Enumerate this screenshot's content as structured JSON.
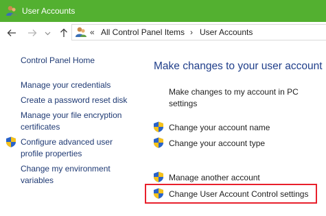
{
  "window": {
    "title": "User Accounts",
    "title_bar_color": "#53b030"
  },
  "nav": {
    "back_icon": "arrow-left-icon",
    "forward_icon": "arrow-right-icon",
    "recent_icon": "chevron-down-icon",
    "up_icon": "arrow-up-icon",
    "overflow": "«",
    "breadcrumbs": [
      "All Control Panel Items",
      "User Accounts"
    ],
    "separator": "›"
  },
  "sidebar": {
    "home": "Control Panel Home",
    "links": [
      {
        "label": "Manage your credentials"
      },
      {
        "label": "Create a password reset disk"
      },
      {
        "label_line1": "Manage your file encryption",
        "label_line2": "certificates"
      },
      {
        "label_line1": "Configure advanced user",
        "label_line2": "profile properties",
        "icon": "uac-shield-icon"
      },
      {
        "label_line1": "Change my environment",
        "label_line2": "variables"
      }
    ]
  },
  "main": {
    "heading": "Make changes to your user account",
    "pc_settings_line1": "Make changes to my account in PC",
    "pc_settings_line2": "settings",
    "actions": [
      {
        "label": "Change your account name",
        "icon": "uac-shield-icon"
      },
      {
        "label": "Change your account type",
        "icon": "uac-shield-icon"
      },
      {
        "label": "Manage another account",
        "icon": "uac-shield-icon"
      },
      {
        "label": "Change User Account Control settings",
        "icon": "uac-shield-icon",
        "highlighted": true
      }
    ],
    "highlight_color": "#e81f2b",
    "link_color": "#1f55b6"
  }
}
